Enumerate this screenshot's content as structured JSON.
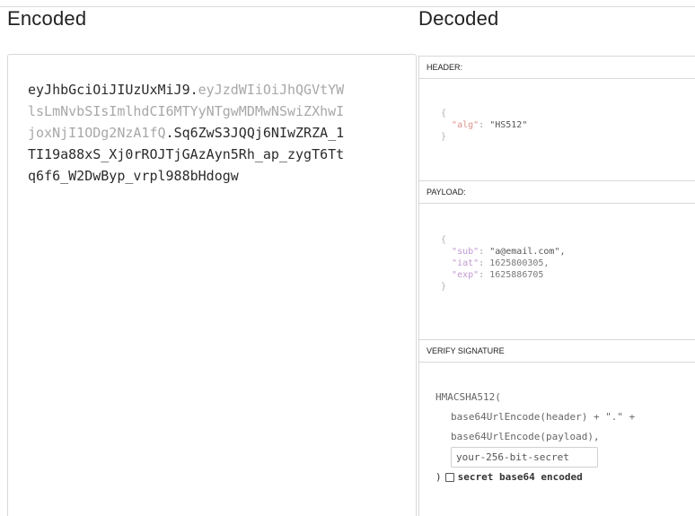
{
  "encoded": {
    "title": "Encoded",
    "token_header": "eyJhbGciOiJIUzUxMiJ9",
    "dot1": ".",
    "token_payload": "eyJzdWIiOiJhQGVtYWlsLmNvbSIsImlhdCI6MTYyNTgwMDMwNSwiZXhwIjoxNjI1ODg2NzA1fQ",
    "dot2": ".",
    "token_signature": "Sq6ZwS3JQQj6NIwZRZA_1TI19a88xS_Xj0rROJTjGAzAyn5Rh_ap_zygT6Ttq6f6_W2DwByp_vrpl988bHdogw"
  },
  "decoded": {
    "title": "Decoded",
    "header": {
      "label": "HEADER:",
      "open_brace": "{",
      "alg_key": "\"alg\"",
      "alg_value": "\"HS512\"",
      "close_brace": "}"
    },
    "payload": {
      "label": "PAYLOAD:",
      "open_brace": "{",
      "sub_key": "\"sub\"",
      "sub_value": "\"a@email.com\",",
      "iat_key": "\"iat\"",
      "iat_value": "1625800305,",
      "exp_key": "\"exp\"",
      "exp_value": "1625886705",
      "close_brace": "}"
    },
    "verify": {
      "label": "VERIFY SIGNATURE",
      "fn_open": "HMACSHA512(",
      "line1": "base64UrlEncode(header) + \".\" +",
      "line2": "base64UrlEncode(payload),",
      "secret_value": "your-256-bit-secret",
      "fn_close": ")",
      "checkbox_label": "secret base64 encoded"
    }
  }
}
